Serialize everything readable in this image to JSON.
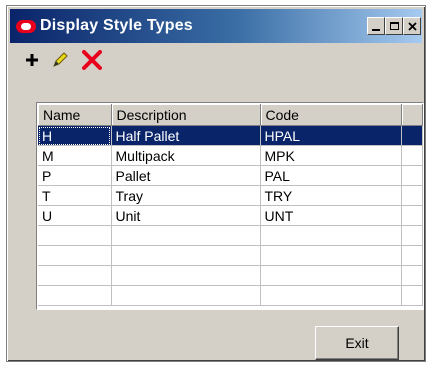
{
  "window": {
    "title": "Display Style Types"
  },
  "toolbar": {
    "add_icon": "plus-icon",
    "edit_icon": "pencil-icon",
    "delete_icon": "delete-x-icon"
  },
  "grid": {
    "columns": [
      "Name",
      "Description",
      "Code"
    ],
    "rows": [
      {
        "name": "H",
        "description": "Half Pallet",
        "code": "HPAL"
      },
      {
        "name": "M",
        "description": "Multipack",
        "code": "MPK"
      },
      {
        "name": "P",
        "description": "Pallet",
        "code": "PAL"
      },
      {
        "name": "T",
        "description": "Tray",
        "code": "TRY"
      },
      {
        "name": "U",
        "description": "Unit",
        "code": "UNT"
      }
    ],
    "selected_row": 0
  },
  "buttons": {
    "exit_label": "Exit"
  },
  "colors": {
    "titlebar_start": "#0a246a",
    "titlebar_end": "#a6caf0",
    "selection": "#0a246a",
    "delete_red": "#e8001c",
    "edit_yellow": "#e8d820"
  }
}
